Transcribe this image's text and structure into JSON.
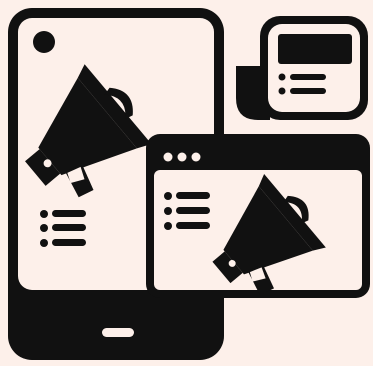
{
  "colors": {
    "background": "#fdf0ea",
    "ink": "#111111",
    "paper": "#fdf0ea"
  },
  "illustration": {
    "subject": "digital-marketing-megaphone-devices",
    "elements": [
      "smartphone-icon",
      "megaphone-icon",
      "list-icon",
      "browser-window-icon",
      "newspaper-icon",
      "home-button-icon",
      "camera-dot-icon"
    ]
  }
}
